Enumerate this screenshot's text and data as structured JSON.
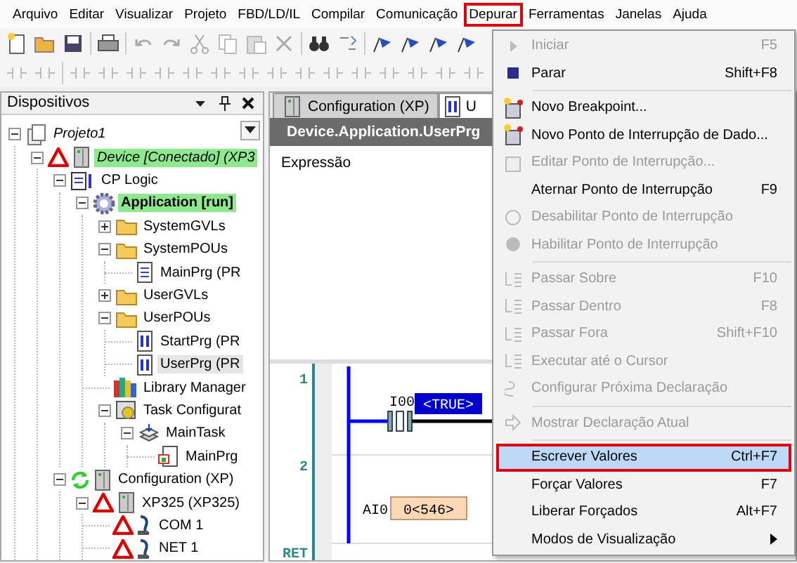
{
  "menu_bar": [
    {
      "label": "Arquivo",
      "selected": false
    },
    {
      "label": "Editar",
      "selected": false
    },
    {
      "label": "Visualizar",
      "selected": false
    },
    {
      "label": "Projeto",
      "selected": false
    },
    {
      "label": "FBD/LD/IL",
      "selected": false
    },
    {
      "label": "Compilar",
      "selected": false
    },
    {
      "label": "Comunicação",
      "selected": false
    },
    {
      "label": "Depurar",
      "selected": true
    },
    {
      "label": "Ferramentas",
      "selected": false
    },
    {
      "label": "Janelas",
      "selected": false
    },
    {
      "label": "Ajuda",
      "selected": false
    }
  ],
  "devices_panel": {
    "title": "Dispositivos",
    "tree": [
      {
        "label": "Projeto1",
        "kind": "project",
        "italic": true,
        "online": false,
        "selected": false,
        "expanded": true,
        "children": [
          {
            "label": "Device [Conectado] (XP3",
            "kind": "device",
            "warning": true,
            "italic": true,
            "online": true,
            "selected": false,
            "expanded": true,
            "children": [
              {
                "label": "CP Logic",
                "kind": "logic",
                "online": false,
                "selected": false,
                "expanded": true,
                "children": [
                  {
                    "label": "Application [run]",
                    "kind": "application",
                    "bold": true,
                    "online": true,
                    "selected": false,
                    "expanded": true,
                    "children": [
                      {
                        "label": "SystemGVLs",
                        "kind": "folder",
                        "online": false,
                        "selected": false,
                        "expanded": false
                      },
                      {
                        "label": "SystemPOUs",
                        "kind": "folder",
                        "online": false,
                        "selected": false,
                        "expanded": true,
                        "children": [
                          {
                            "label": "MainPrg (PR",
                            "kind": "program",
                            "online": false,
                            "selected": false
                          }
                        ]
                      },
                      {
                        "label": "UserGVLs",
                        "kind": "folder",
                        "online": false,
                        "selected": false,
                        "expanded": false
                      },
                      {
                        "label": "UserPOUs",
                        "kind": "folder",
                        "online": false,
                        "selected": false,
                        "expanded": true,
                        "children": [
                          {
                            "label": "StartPrg (PR",
                            "kind": "ladder",
                            "online": false,
                            "selected": false
                          },
                          {
                            "label": "UserPrg (PR",
                            "kind": "ladder",
                            "online": false,
                            "selected": true
                          }
                        ]
                      },
                      {
                        "label": "Library Manager",
                        "kind": "library",
                        "online": false,
                        "selected": false
                      },
                      {
                        "label": "Task Configurat",
                        "kind": "tasks",
                        "online": false,
                        "selected": false,
                        "expanded": true,
                        "children": [
                          {
                            "label": "MainTask",
                            "kind": "task",
                            "online": false,
                            "selected": false,
                            "expanded": true,
                            "children": [
                              {
                                "label": "MainPrg",
                                "kind": "call",
                                "online": false,
                                "selected": false
                              }
                            ]
                          }
                        ]
                      }
                    ]
                  }
                ]
              },
              {
                "label": "Configuration (XP)",
                "kind": "config",
                "online": false,
                "selected": false,
                "expanded": true,
                "children": [
                  {
                    "label": "XP325 (XP325)",
                    "kind": "device",
                    "warning": true,
                    "online": false,
                    "selected": false,
                    "expanded": true,
                    "children": [
                      {
                        "label": "COM 1",
                        "kind": "port",
                        "warning": true,
                        "online": false,
                        "selected": false
                      },
                      {
                        "label": "NET 1",
                        "kind": "port",
                        "warning": true,
                        "online": false,
                        "selected": false
                      }
                    ]
                  }
                ]
              }
            ]
          }
        ]
      }
    ]
  },
  "editor": {
    "tabs": [
      {
        "label": "Configuration (XP)",
        "kind": "config",
        "selected": false
      },
      {
        "label": "U",
        "kind": "ladder",
        "selected": true
      }
    ],
    "header": "Device.Application.UserPrg",
    "watch_column": "Expressão",
    "ladder": {
      "rungs": [
        "1",
        "2",
        "RET"
      ],
      "contact": {
        "name": "I00",
        "value": "<TRUE>"
      },
      "analog": {
        "name": "AI0",
        "value": "0<546>"
      }
    }
  },
  "debug_menu": [
    {
      "kind": "item",
      "label": "Iniciar",
      "shortcut": "F5",
      "disabled": true,
      "selected": false
    },
    {
      "kind": "item",
      "label": "Parar",
      "shortcut": "Shift+F8",
      "disabled": false,
      "selected": false
    },
    {
      "kind": "separator"
    },
    {
      "kind": "item",
      "label": "Novo Breakpoint...",
      "disabled": false,
      "selected": false
    },
    {
      "kind": "item",
      "label": "Novo Ponto de Interrupção de Dado...",
      "disabled": false,
      "selected": false
    },
    {
      "kind": "item",
      "label": "Editar Ponto de Interrupção...",
      "disabled": true,
      "selected": false
    },
    {
      "kind": "item",
      "label": "Aternar Ponto de Interrupção",
      "shortcut": "F9",
      "disabled": false,
      "selected": false
    },
    {
      "kind": "item",
      "label": "Desabilitar Ponto de Interrupção",
      "disabled": true,
      "selected": false
    },
    {
      "kind": "item",
      "label": "Habilitar Ponto de Interrupção",
      "disabled": true,
      "selected": false
    },
    {
      "kind": "separator"
    },
    {
      "kind": "item",
      "label": "Passar Sobre",
      "shortcut": "F10",
      "disabled": true,
      "selected": false
    },
    {
      "kind": "item",
      "label": "Passar Dentro",
      "shortcut": "F8",
      "disabled": true,
      "selected": false
    },
    {
      "kind": "item",
      "label": "Passar Fora",
      "shortcut": "Shift+F10",
      "disabled": true,
      "selected": false
    },
    {
      "kind": "item",
      "label": "Executar até o Cursor",
      "disabled": true,
      "selected": false
    },
    {
      "kind": "item",
      "label": "Configurar Próxima Declaração",
      "disabled": true,
      "selected": false
    },
    {
      "kind": "separator"
    },
    {
      "kind": "item",
      "label": "Mostrar Declaração Atual",
      "disabled": true,
      "selected": false
    },
    {
      "kind": "separator"
    },
    {
      "kind": "item",
      "label": "Escrever Valores",
      "shortcut": "Ctrl+F7",
      "disabled": false,
      "selected": true
    },
    {
      "kind": "item",
      "label": "Forçar Valores",
      "shortcut": "F7",
      "disabled": false,
      "selected": false
    },
    {
      "kind": "item",
      "label": "Liberar Forçados",
      "shortcut": "Alt+F7",
      "disabled": false,
      "selected": false
    },
    {
      "kind": "submenu",
      "label": "Modos de Visualização",
      "disabled": false,
      "selected": false
    }
  ]
}
